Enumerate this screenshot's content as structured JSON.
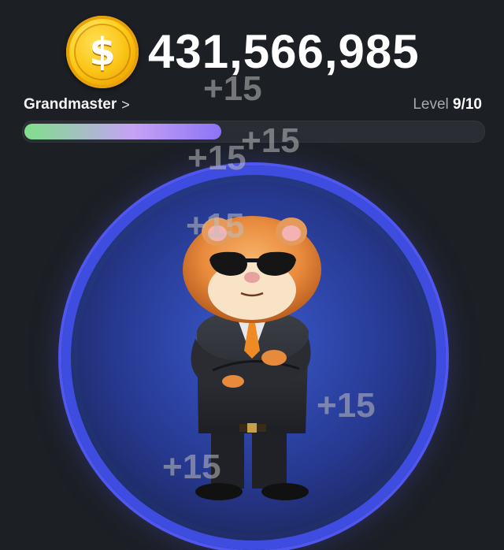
{
  "balance": {
    "coin_icon": "dollar-coin-icon",
    "value": "431,566,985"
  },
  "rank": {
    "name": "Grandmaster",
    "chevron": ">"
  },
  "level": {
    "label": "Level",
    "current": "9/10"
  },
  "progress": {
    "fraction": 0.43
  },
  "tap_popups": [
    "+15",
    "+15",
    "+15",
    "+15",
    "+15",
    "+15"
  ]
}
